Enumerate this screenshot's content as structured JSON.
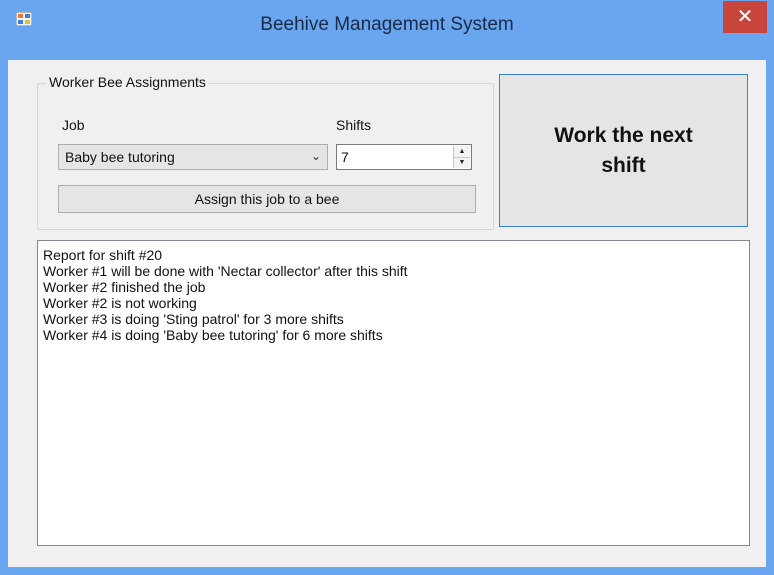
{
  "window": {
    "title": "Beehive Management System",
    "close_glyph": "✕",
    "icon": "app-window-icon"
  },
  "group": {
    "title": "Worker Bee Assignments",
    "job_label": "Job",
    "shifts_label": "Shifts",
    "job_selected": "Baby bee tutoring",
    "shifts_value": "7",
    "assign_button": "Assign this job to a bee"
  },
  "work_button": "Work the next shift",
  "report": {
    "lines": [
      "Report for shift #20",
      "Worker #1 will be done with 'Nectar collector' after this shift",
      "Worker #2 finished the job",
      "Worker #2 is not working",
      "Worker #3 is doing 'Sting patrol' for 3 more shifts",
      "Worker #4 is doing 'Baby bee tutoring' for 6 more shifts"
    ]
  },
  "colors": {
    "title_bar": "#6aa5f0",
    "close_button": "#c7453a",
    "client_background": "#f0f0f0",
    "focus_border": "#3c7fd3"
  }
}
